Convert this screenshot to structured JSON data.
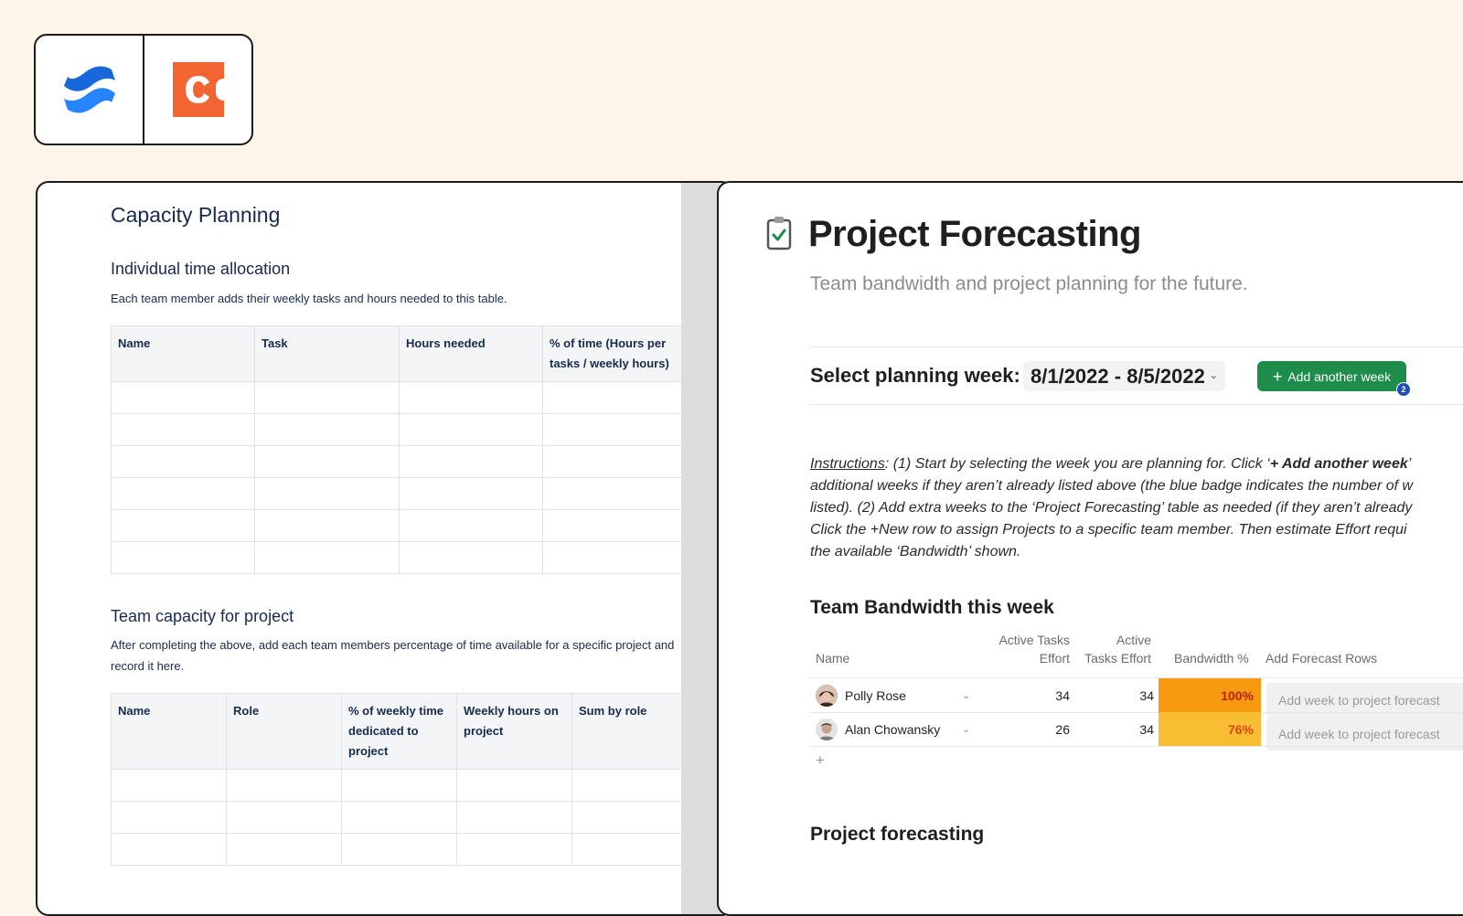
{
  "colors": {
    "background": "#fdf5ea",
    "confluence_blue": "#2684ff",
    "coda_orange": "#f26532",
    "button_green": "#1e8c4a",
    "badge_blue": "#1f4fbd",
    "bandwidth_high": "#f79a10",
    "bandwidth_mid": "#f9bd33"
  },
  "logos": [
    "confluence-logo",
    "coda-logo"
  ],
  "confluence": {
    "title": "Capacity Planning",
    "section1": {
      "heading": "Individual time allocation",
      "description": "Each team member adds their weekly tasks and hours needed to this table.",
      "columns": [
        "Name",
        "Task",
        "Hours needed",
        "% of time (Hours per tasks / weekly hours)"
      ]
    },
    "section2": {
      "heading": "Team capacity for project",
      "description": "After completing the above, add each team members percentage of time available for a specific project and record it here.",
      "columns": [
        "Name",
        "Role",
        "% of weekly time dedicated to project",
        "Weekly hours on project",
        "Sum by role"
      ]
    }
  },
  "coda": {
    "page_icon": "clipboard-check-icon",
    "title": "Project Forecasting",
    "subtitle": "Team bandwidth and project planning for the future.",
    "week_label": "Select planning week:",
    "week_value": "8/1/2022 - 8/5/2022",
    "add_week_label": "Add another week",
    "add_week_badge": "2",
    "instructions": {
      "label": "Instructions",
      "line1_a": ": (1) Start by selecting the week you are planning for. Click ‘",
      "line1_b": "+ Add another week",
      "line1_c": "’",
      "line2": "additional weeks if they aren’t already listed above (the blue badge indicates the number of w",
      "line3": "listed). (2) Add extra weeks to the ‘Project Forecasting’ table as needed (if they aren’t already",
      "line4": "Click the +New row to assign Projects to a specific team member. Then estimate Effort requi",
      "line5": "the available ‘Bandwidth’ shown."
    },
    "bandwidth": {
      "heading": "Team Bandwidth this week",
      "columns": {
        "name": "Name",
        "active_tasks_1": "Active Tasks",
        "active_tasks_2": "Effort",
        "active_effort_1": "Active",
        "active_effort_2": "Tasks Effort",
        "bandwidth": "Bandwidth %",
        "add_forecast": "Add Forecast Rows"
      },
      "rows": [
        {
          "name": "Polly Rose",
          "active_tasks": "34",
          "active_effort": "34",
          "bandwidth": "100%",
          "button": "Add week to project forecast"
        },
        {
          "name": "Alan Chowansky",
          "active_tasks": "26",
          "active_effort": "34",
          "bandwidth": "76%",
          "button": "Add week to project forecast"
        }
      ],
      "add_row": "+"
    },
    "forecasting_heading": "Project forecasting"
  }
}
